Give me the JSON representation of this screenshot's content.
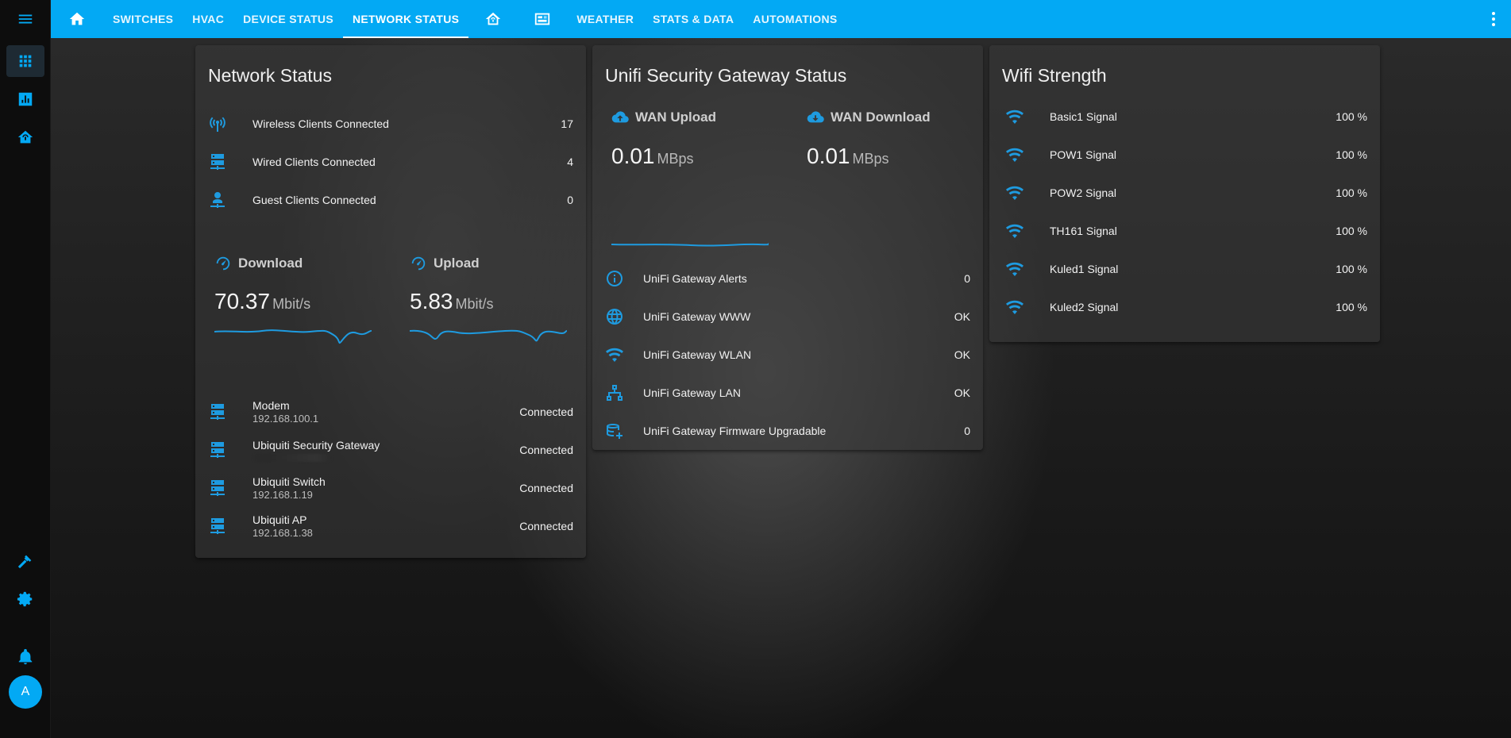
{
  "topbar": {
    "tabs": [
      {
        "type": "icon",
        "icon": "home-icon"
      },
      {
        "type": "text",
        "label": "SWITCHES"
      },
      {
        "type": "text",
        "label": "HVAC"
      },
      {
        "type": "text",
        "label": "DEVICE STATUS"
      },
      {
        "type": "text",
        "label": "NETWORK STATUS",
        "active": true
      },
      {
        "type": "icon",
        "icon": "home-automation-icon"
      },
      {
        "type": "icon",
        "icon": "server-rack-icon"
      },
      {
        "type": "text",
        "label": "WEATHER"
      },
      {
        "type": "text",
        "label": "STATS & DATA"
      },
      {
        "type": "text",
        "label": "AUTOMATIONS"
      }
    ]
  },
  "sidebar": {
    "items": [
      "menu-icon",
      "grid-icon",
      "chart-icon",
      "home-automation-icon",
      "hammer-icon",
      "gear-icon",
      "bell-icon"
    ],
    "avatar": "A"
  },
  "network_status": {
    "title": "Network Status",
    "clients": [
      {
        "label": "Wireless Clients Connected",
        "value": "17",
        "icon": "access-point-icon"
      },
      {
        "label": "Wired Clients Connected",
        "value": "4",
        "icon": "server-network-icon"
      },
      {
        "label": "Guest Clients Connected",
        "value": "0",
        "icon": "account-network-icon"
      }
    ],
    "download": {
      "label": "Download",
      "value": "70.37",
      "unit": "Mbit/s"
    },
    "upload": {
      "label": "Upload",
      "value": "5.83",
      "unit": "Mbit/s"
    },
    "devices": [
      {
        "name": "Modem",
        "ip": "192.168.100.1",
        "status": "Connected"
      },
      {
        "name": "Ubiquiti Security Gateway",
        "ip": "",
        "status": "Connected"
      },
      {
        "name": "Ubiquiti Switch",
        "ip": "192.168.1.19",
        "status": "Connected"
      },
      {
        "name": "Ubiquiti AP",
        "ip": "192.168.1.38",
        "status": "Connected"
      }
    ]
  },
  "gateway_status": {
    "title": "Unifi Security Gateway Status",
    "wan_upload": {
      "label": "WAN Upload",
      "value": "0.01",
      "unit": "MBps"
    },
    "wan_download": {
      "label": "WAN Download",
      "value": "0.01",
      "unit": "MBps"
    },
    "rows": [
      {
        "label": "UniFi Gateway Alerts",
        "value": "0",
        "icon": "information-icon"
      },
      {
        "label": "UniFi Gateway WWW",
        "value": "OK",
        "icon": "web-icon"
      },
      {
        "label": "UniFi Gateway WLAN",
        "value": "OK",
        "icon": "wifi-icon"
      },
      {
        "label": "UniFi Gateway LAN",
        "value": "OK",
        "icon": "lan-icon"
      },
      {
        "label": "UniFi Gateway Firmware Upgradable",
        "value": "0",
        "icon": "database-plus-icon"
      }
    ]
  },
  "wifi_strength": {
    "title": "Wifi Strength",
    "rows": [
      {
        "label": "Basic1 Signal",
        "value": "100 %"
      },
      {
        "label": "POW1 Signal",
        "value": "100 %"
      },
      {
        "label": "POW2 Signal",
        "value": "100 %"
      },
      {
        "label": "TH161 Signal",
        "value": "100 %"
      },
      {
        "label": "Kuled1 Signal",
        "value": "100 %"
      },
      {
        "label": "Kuled2 Signal",
        "value": "100 %"
      }
    ]
  },
  "colors": {
    "accent": "#03a9f4",
    "icon": "#1e9be0",
    "sidebar": "#0d0d0d"
  }
}
